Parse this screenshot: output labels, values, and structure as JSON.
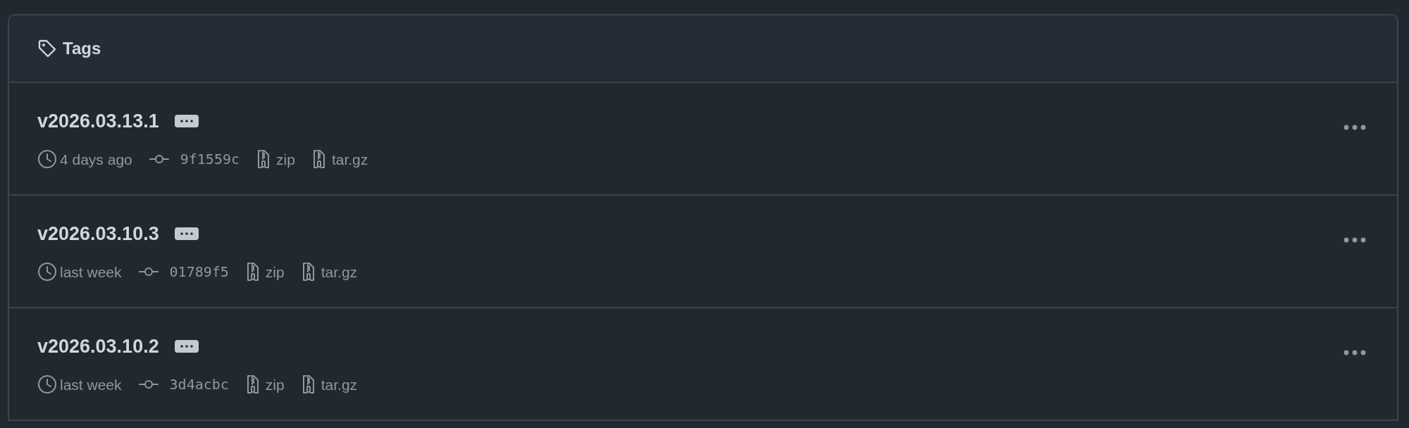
{
  "header": {
    "title": "Tags"
  },
  "tags": [
    {
      "name": "v2026.03.13.1",
      "time": "4 days ago",
      "commit": "9f1559c",
      "downloads": [
        "zip",
        "tar.gz"
      ]
    },
    {
      "name": "v2026.03.10.3",
      "time": "last week",
      "commit": "01789f5",
      "downloads": [
        "zip",
        "tar.gz"
      ]
    },
    {
      "name": "v2026.03.10.2",
      "time": "last week",
      "commit": "3d4acbc",
      "downloads": [
        "zip",
        "tar.gz"
      ]
    }
  ]
}
